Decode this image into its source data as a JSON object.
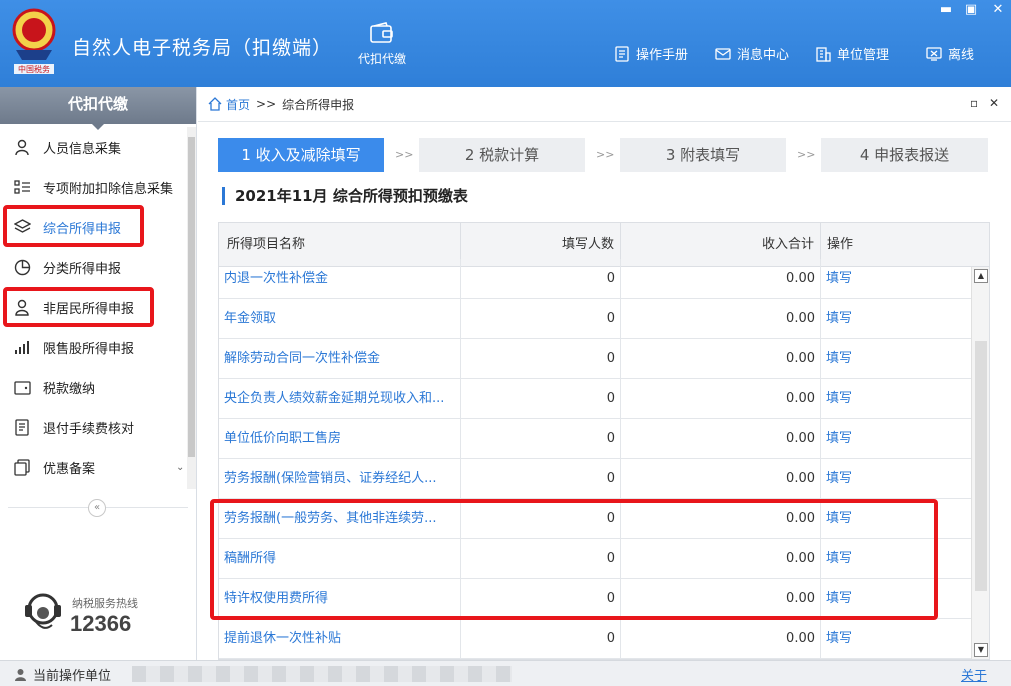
{
  "header": {
    "app_title": "自然人电子税务局（扣缴端）",
    "withhold_label": "代扣代缴",
    "nav": [
      {
        "label": "操作手册",
        "icon": "manual-icon"
      },
      {
        "label": "消息中心",
        "icon": "mail-icon"
      },
      {
        "label": "单位管理",
        "icon": "building-icon"
      },
      {
        "label": "离线",
        "icon": "offline-icon"
      }
    ],
    "logo_text": "中国税务"
  },
  "sidebar": {
    "title": "代扣代缴",
    "items": [
      {
        "label": "人员信息采集",
        "icon": "person-icon"
      },
      {
        "label": "专项附加扣除信息采集",
        "icon": "list-icon"
      },
      {
        "label": "综合所得申报",
        "icon": "layers-icon",
        "active": true
      },
      {
        "label": "分类所得申报",
        "icon": "pie-icon"
      },
      {
        "label": "非居民所得申报",
        "icon": "person-outline-icon"
      },
      {
        "label": "限售股所得申报",
        "icon": "bar-chart-icon"
      },
      {
        "label": "税款缴纳",
        "icon": "wallet-icon"
      },
      {
        "label": "退付手续费核对",
        "icon": "document-icon"
      },
      {
        "label": "优惠备案",
        "icon": "copy-icon"
      }
    ],
    "hotline_label": "纳税服务热线",
    "hotline_number": "12366"
  },
  "breadcrumb": {
    "home": "首页",
    "separator": ">>",
    "current": "综合所得申报"
  },
  "steps": [
    {
      "label": "1 收入及减除填写",
      "active": true
    },
    {
      "label": "2 税款计算",
      "active": false
    },
    {
      "label": "3 附表填写",
      "active": false
    },
    {
      "label": "4 申报表报送",
      "active": false
    }
  ],
  "step_arrow": ">>",
  "section_title": "2021年11月  综合所得预扣预缴表",
  "table": {
    "headers": [
      "所得项目名称",
      "填写人数",
      "收入合计",
      "操作"
    ],
    "rows": [
      {
        "name": "内退一次性补偿金",
        "count": "0",
        "income": "0.00",
        "action": "填写"
      },
      {
        "name": "年金领取",
        "count": "0",
        "income": "0.00",
        "action": "填写"
      },
      {
        "name": "解除劳动合同一次性补偿金",
        "count": "0",
        "income": "0.00",
        "action": "填写"
      },
      {
        "name": "央企负责人绩效薪金延期兑现收入和...",
        "count": "0",
        "income": "0.00",
        "action": "填写"
      },
      {
        "name": "单位低价向职工售房",
        "count": "0",
        "income": "0.00",
        "action": "填写"
      },
      {
        "name": "劳务报酬(保险营销员、证券经纪人...",
        "count": "0",
        "income": "0.00",
        "action": "填写"
      },
      {
        "name": "劳务报酬(一般劳务、其他非连续劳...",
        "count": "0",
        "income": "0.00",
        "action": "填写"
      },
      {
        "name": "稿酬所得",
        "count": "0",
        "income": "0.00",
        "action": "填写"
      },
      {
        "name": "特许权使用费所得",
        "count": "0",
        "income": "0.00",
        "action": "填写"
      },
      {
        "name": "提前退休一次性补贴",
        "count": "0",
        "income": "0.00",
        "action": "填写"
      }
    ]
  },
  "statusbar": {
    "label": "当前操作单位",
    "about": "关于"
  },
  "colors": {
    "header_blue": "#3b8beb",
    "link_blue": "#2b78d6",
    "highlight_red": "#e8161b"
  }
}
